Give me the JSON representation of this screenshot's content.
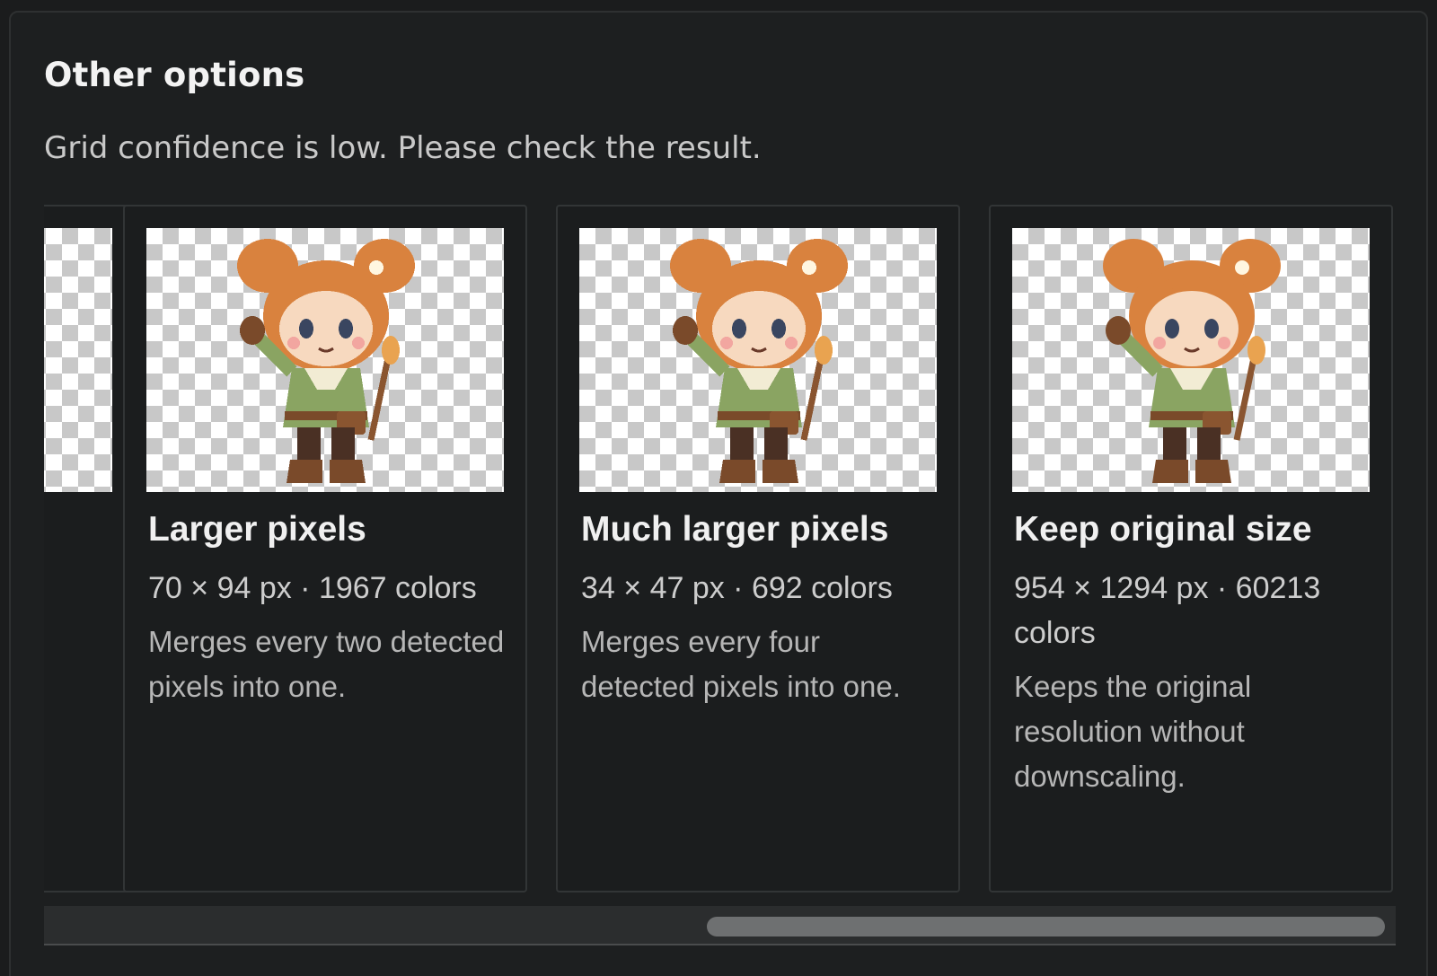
{
  "section": {
    "title": "Other options",
    "subtitle": "Grid confidence is low. Please check the result."
  },
  "cards": [
    {
      "title": "Larger pixels",
      "meta": "70 × 94 px · 1967 colors",
      "description": "Merges every two detected pixels into one."
    },
    {
      "title": "Much larger pixels",
      "meta": "34 × 47 px · 692 colors",
      "description": "Merges every four detected pixels into one."
    },
    {
      "title": "Keep original size",
      "meta": "954 × 1294 px · 60213 colors",
      "description": "Keeps the original resolution without downscaling."
    }
  ],
  "scrollbar": {
    "visible_fraction": 0.51,
    "position_fraction": 1.0
  },
  "colors": {
    "background": "#1d1f20",
    "card_border": "#323536",
    "hair": "#d9823e",
    "tunic": "#8aa462",
    "boots": "#7a4a2a"
  }
}
